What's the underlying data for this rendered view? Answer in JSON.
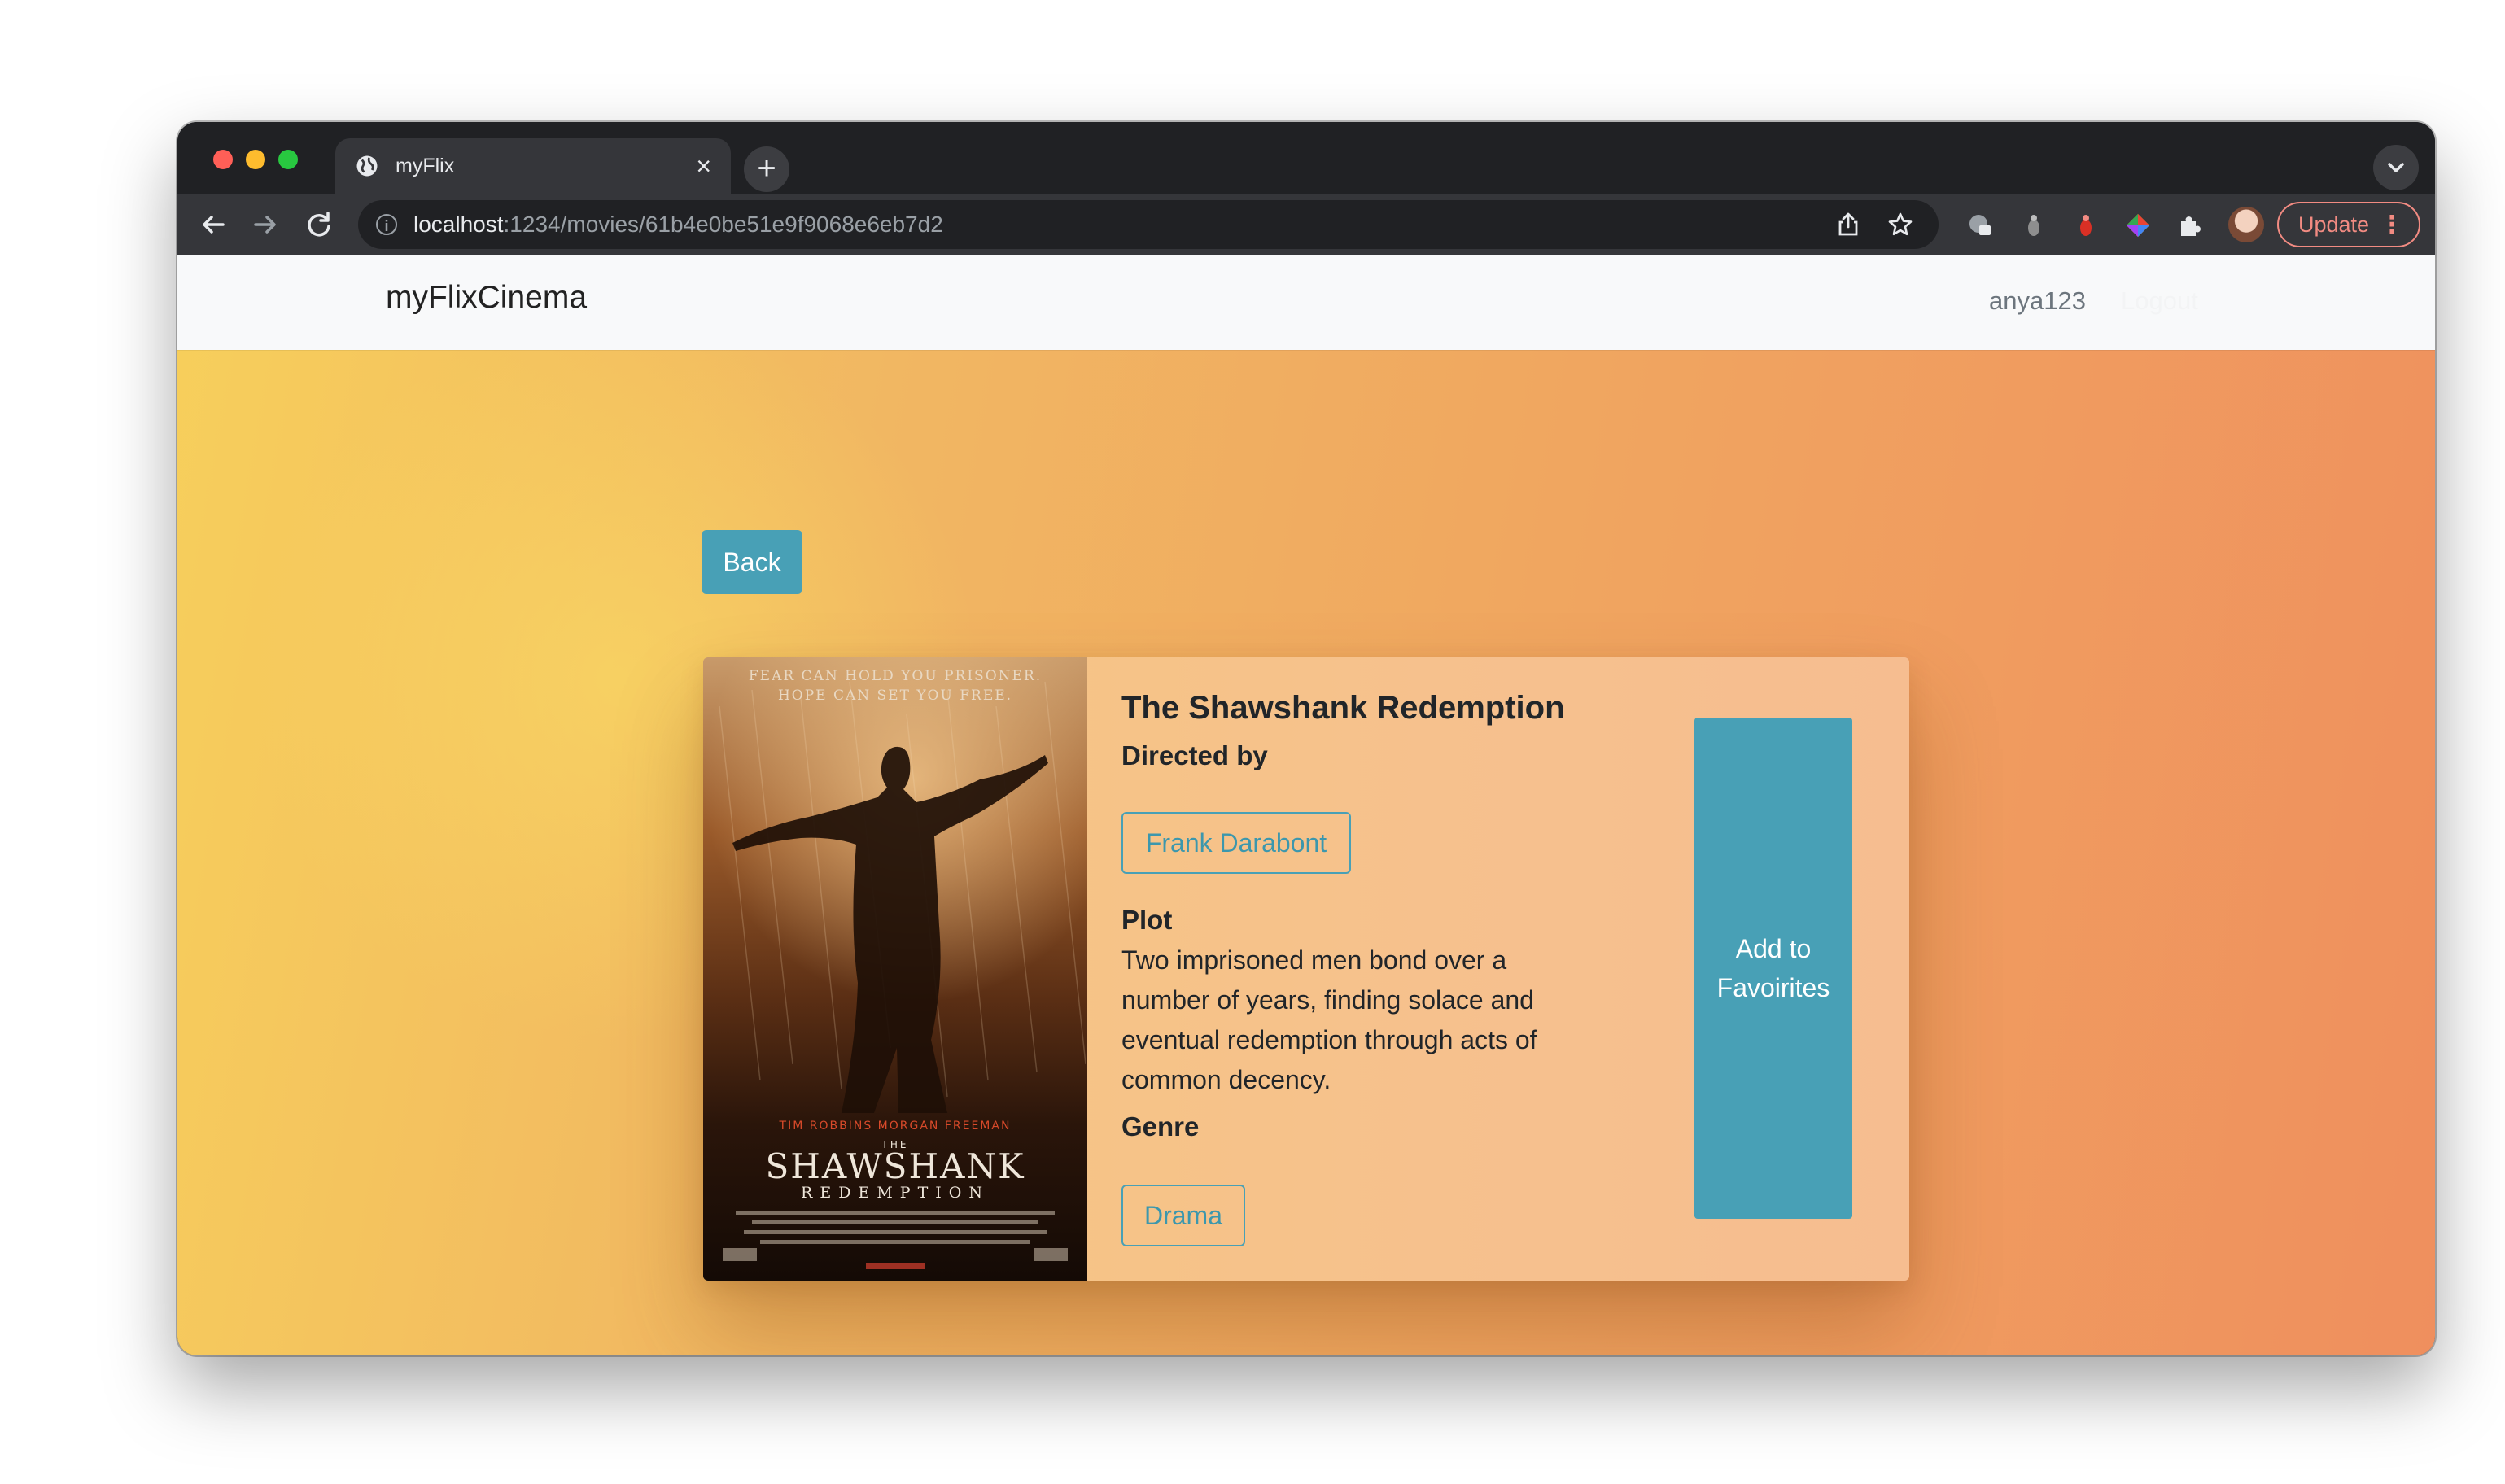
{
  "browser": {
    "tab_title": "myFlix",
    "url_host": "localhost",
    "url_path": ":1234/movies/61b4e0be51e9f9068e6eb7d2",
    "update_label": "Update"
  },
  "navbar": {
    "brand": "myFlixCinema",
    "username": "anya123",
    "logout": "Logout"
  },
  "page": {
    "back_label": "Back"
  },
  "movie": {
    "title": "The Shawshank Redemption",
    "directed_by_label": "Directed by",
    "director": "Frank Darabont",
    "plot_label": "Plot",
    "plot": "Two imprisoned men bond over a number of years, finding solace and eventual redemption through acts of common decency.",
    "genre_label": "Genre",
    "genre": "Drama",
    "favorite_label": "Add to Favoirites",
    "poster": {
      "tagline_1": "FEAR CAN HOLD YOU PRISONER.",
      "tagline_2": "HOPE CAN SET YOU FREE.",
      "cast": "TIM ROBBINS    MORGAN FREEMAN",
      "the": "THE",
      "name_1": "SHAWSHANK",
      "name_2": "REDEMPTION"
    }
  },
  "colors": {
    "accent": "#48a0b6",
    "navbar_bg": "#f8f9fa",
    "chrome_dark": "#202124",
    "update_red": "#f28b82"
  }
}
